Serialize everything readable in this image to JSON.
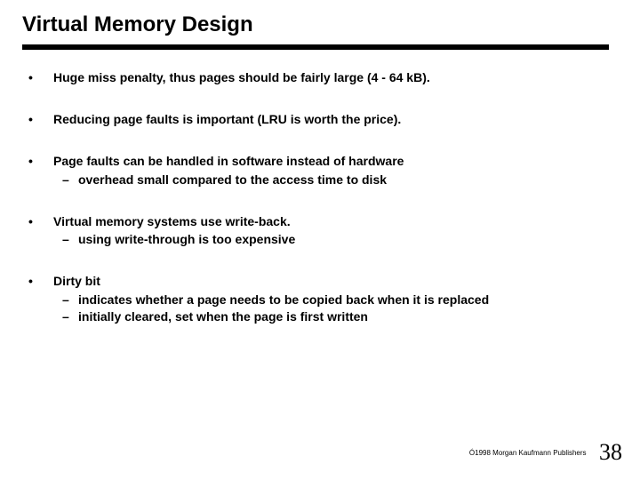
{
  "title": "Virtual Memory Design",
  "bullets": {
    "b0": {
      "text": "Huge miss penalty, thus pages should be fairly large (4 - 64 kB)."
    },
    "b1": {
      "text": "Reducing page faults is important (LRU is worth the price)."
    },
    "b2": {
      "text": "Page faults can be handled in software instead of hardware",
      "sub": {
        "s0": "overhead small compared to the access time to disk"
      }
    },
    "b3": {
      "text": "Virtual memory systems use write-back.",
      "sub": {
        "s0": "using write-through is too expensive"
      }
    },
    "b4": {
      "text": "Dirty bit",
      "sub": {
        "s0": "indicates whether a page needs to be copied back when it is replaced",
        "s1": "initially cleared, set when the page is first written"
      }
    }
  },
  "footer": {
    "copyright": "Ó1998 Morgan Kaufmann Publishers",
    "page": "38"
  }
}
